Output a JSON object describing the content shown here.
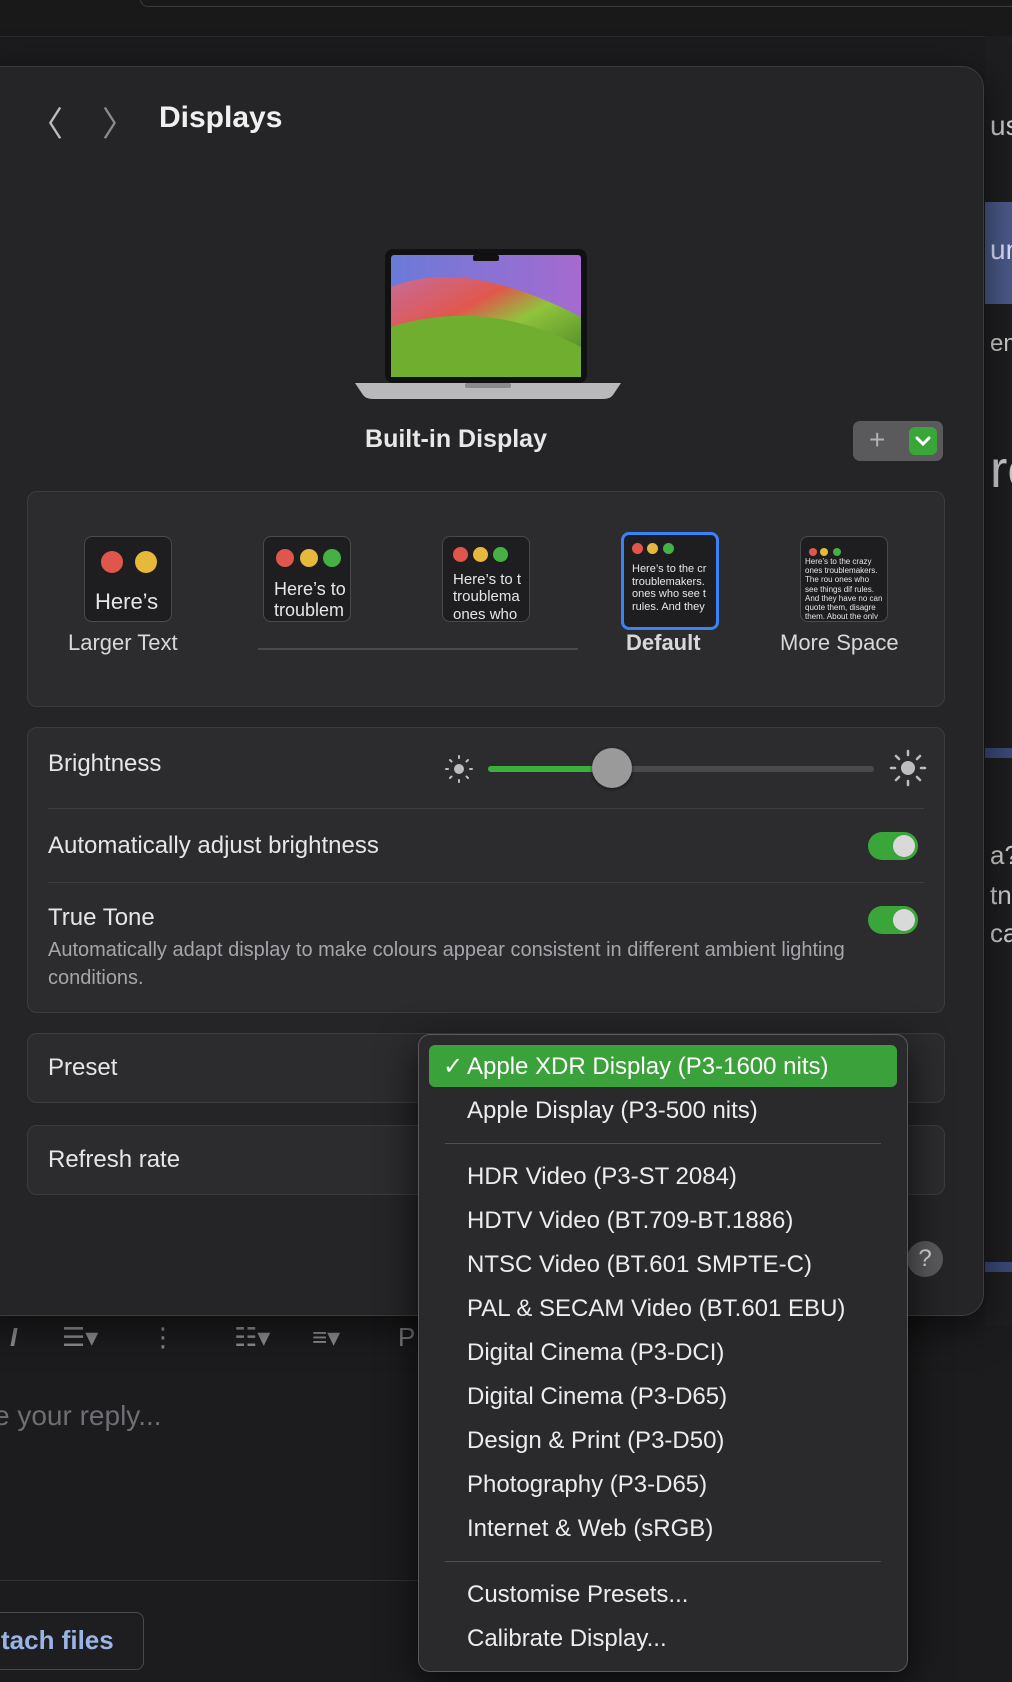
{
  "background": {
    "side_fragments": [
      "us",
      "un",
      "em",
      "re",
      "a?",
      "tn",
      "ca"
    ],
    "reply_placeholder": "e your reply...",
    "attach_label": "tach files",
    "toolbar_fragment": "P"
  },
  "window": {
    "title": "Displays",
    "display_name": "Built-in Display",
    "add_icon": "+"
  },
  "resolution": {
    "options": [
      {
        "label": "Larger Text",
        "sample": "Here’s"
      },
      {
        "label": "",
        "sample": "Here’s to troublem"
      },
      {
        "label": "",
        "sample": "Here’s to t troublema ones who"
      },
      {
        "label": "Default",
        "sample": "Here’s to the cr troublemakers. ones who see t rules. And they"
      },
      {
        "label": "More Space",
        "sample": "Here’s to the crazy ones troublemakers. The rou ones who see things dif rules. And they have no can quote them, disagre them. About the only th Because they change th"
      }
    ],
    "selected": "Default"
  },
  "brightness": {
    "label": "Brightness",
    "level": 0.32,
    "auto_label": "Automatically adjust brightness",
    "auto_on": true,
    "truetone_label": "True Tone",
    "truetone_on": true,
    "truetone_desc": "Automatically adapt display to make colours appear consistent in different ambient lighting conditions."
  },
  "preset": {
    "label": "Preset"
  },
  "refresh": {
    "label": "Refresh rate"
  },
  "help_label": "?",
  "menu": {
    "group1": [
      "Apple XDR Display (P3-1600 nits)",
      "Apple Display (P3-500 nits)"
    ],
    "group2": [
      "HDR Video (P3-ST 2084)",
      "HDTV Video (BT.709-BT.1886)",
      "NTSC Video (BT.601 SMPTE-C)",
      "PAL & SECAM Video (BT.601 EBU)",
      "Digital Cinema (P3-DCI)",
      "Digital Cinema (P3-D65)",
      "Design & Print (P3-D50)",
      "Photography (P3-D65)",
      "Internet & Web (sRGB)"
    ],
    "group3": [
      "Customise Presets...",
      "Calibrate Display..."
    ],
    "selected": "Apple XDR Display (P3-1600 nits)",
    "check": "✓"
  },
  "colors": {
    "accent_green": "#3ba23b",
    "selection_blue": "#3b82f6"
  }
}
